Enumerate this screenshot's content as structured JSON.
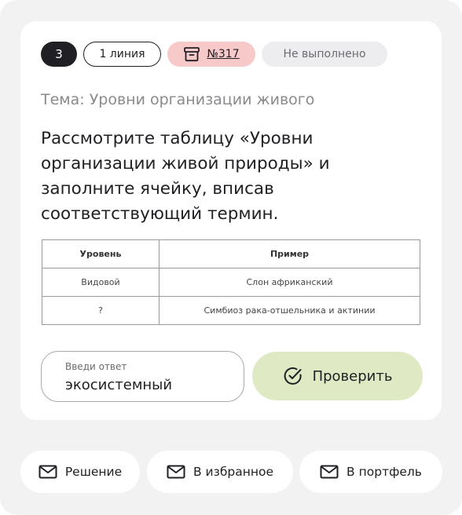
{
  "badges": {
    "number": "3",
    "line": "1 линия",
    "task_id": "№317",
    "status": "Не выполнено"
  },
  "topic": "Тема: Уровни организации живого",
  "question": "Рассмотрите таблицу «Уровни организации живой природы» и заполните ячейку, вписав соответствующий термин.",
  "table": {
    "headers": [
      "Уровень",
      "Пример"
    ],
    "rows": [
      [
        "Видовой",
        "Слон африканский"
      ],
      [
        "?",
        "Симбиоз рака-отшельника и актинии"
      ]
    ]
  },
  "answer": {
    "label": "Введи ответ",
    "value": "экосистемный"
  },
  "check_button": "Проверить",
  "actions": {
    "solution": "Решение",
    "favorites": "В избранное",
    "portfolio": "В портфель"
  },
  "colors": {
    "accent_green": "#dfeac4",
    "id_badge_pink": "#f8c9c9",
    "dark": "#1f1f24"
  },
  "icons": {
    "id_badge": "archive-box-icon",
    "check_button": "check-circle-icon",
    "actions": "envelope-icon"
  }
}
